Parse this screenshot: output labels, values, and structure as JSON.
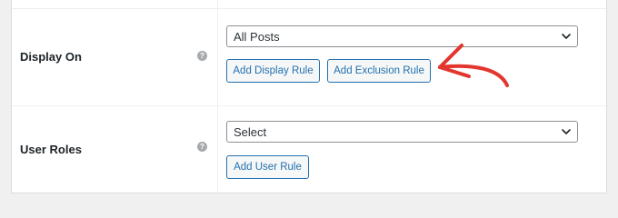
{
  "rows": {
    "display_on": {
      "label": "Display On",
      "help_icon": "question-icon",
      "select_value": "All Posts",
      "buttons": {
        "add_display_rule": "Add Display Rule",
        "add_exclusion_rule": "Add Exclusion Rule"
      }
    },
    "user_roles": {
      "label": "User Roles",
      "help_icon": "question-icon",
      "select_value": "Select",
      "buttons": {
        "add_user_rule": "Add User Rule"
      }
    }
  },
  "colors": {
    "accent": "#2271b1",
    "annotation_arrow": "#e2362e",
    "page_background": "#f0f0f1"
  }
}
